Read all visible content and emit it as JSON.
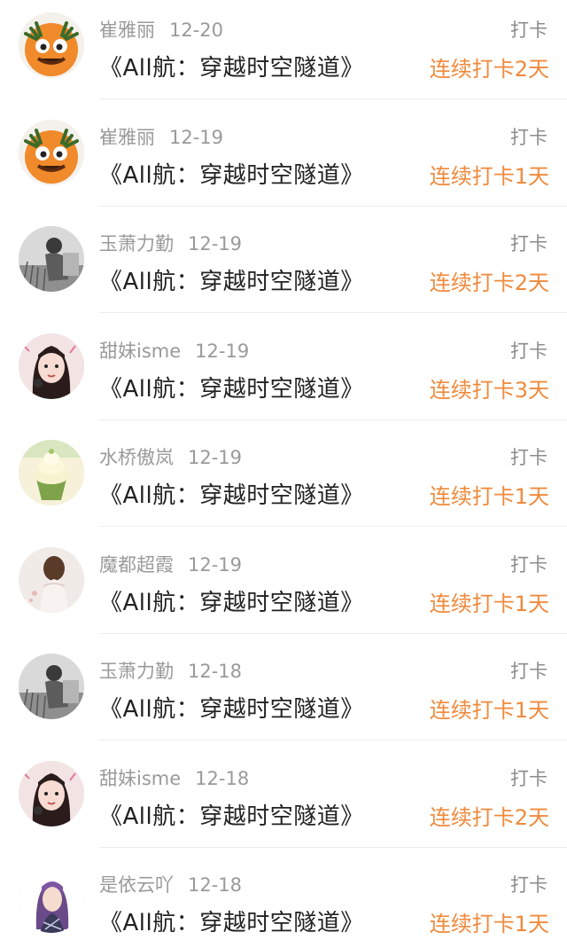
{
  "feed": {
    "items": [
      {
        "username": "崔雅丽",
        "date": "12-20",
        "action": "打卡",
        "title": "《All航：穿越时空隧道》",
        "streak": "连续打卡2天",
        "avatar": "orange-monster"
      },
      {
        "username": "崔雅丽",
        "date": "12-19",
        "action": "打卡",
        "title": "《All航：穿越时空隧道》",
        "streak": "连续打卡1天",
        "avatar": "orange-monster"
      },
      {
        "username": "玉萧力勤",
        "date": "12-19",
        "action": "打卡",
        "title": "《All航：穿越时空隧道》",
        "streak": "连续打卡2天",
        "avatar": "grayscale-photo"
      },
      {
        "username": "甜妹isme",
        "date": "12-19",
        "action": "打卡",
        "title": "《All航：穿越时空隧道》",
        "streak": "连续打卡3天",
        "avatar": "girl-photo"
      },
      {
        "username": "水桥傲岚",
        "date": "12-19",
        "action": "打卡",
        "title": "《All航：穿越时空隧道》",
        "streak": "连续打卡1天",
        "avatar": "cupcake"
      },
      {
        "username": "魔都超霞",
        "date": "12-19",
        "action": "打卡",
        "title": "《All航：穿越时空隧道》",
        "streak": "连续打卡1天",
        "avatar": "woman-back"
      },
      {
        "username": "玉萧力勤",
        "date": "12-18",
        "action": "打卡",
        "title": "《All航：穿越时空隧道》",
        "streak": "连续打卡1天",
        "avatar": "grayscale-photo"
      },
      {
        "username": "甜妹isme",
        "date": "12-18",
        "action": "打卡",
        "title": "《All航：穿越时空隧道》",
        "streak": "连续打卡2天",
        "avatar": "girl-photo"
      },
      {
        "username": "是依云吖",
        "date": "12-18",
        "action": "打卡",
        "title": "《All航：穿越时空隧道》",
        "streak": "连续打卡1天",
        "avatar": "purple-hair-girl"
      }
    ]
  },
  "colors": {
    "streak": "#f08a3c",
    "meta": "#9a9a9a",
    "title": "#222222",
    "divider": "#ededed"
  }
}
